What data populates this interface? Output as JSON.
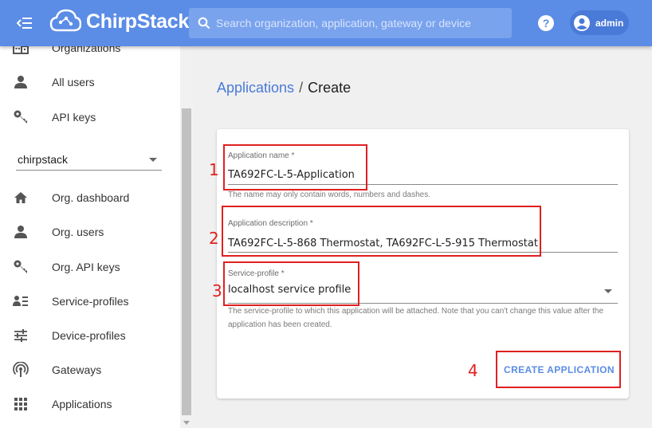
{
  "app": {
    "name": "ChirpStack"
  },
  "search": {
    "placeholder": "Search organization, application, gateway or device"
  },
  "user": {
    "name": "admin"
  },
  "sidebar": {
    "admin_items": [
      {
        "label": "Organizations",
        "icon": "organizations-icon"
      },
      {
        "label": "All users",
        "icon": "person-icon"
      },
      {
        "label": "API keys",
        "icon": "key-icon"
      }
    ],
    "organization_select": {
      "value": "chirpstack"
    },
    "org_items": [
      {
        "label": "Org. dashboard",
        "icon": "home-icon"
      },
      {
        "label": "Org. users",
        "icon": "person-icon"
      },
      {
        "label": "Org. API keys",
        "icon": "key-icon"
      },
      {
        "label": "Service-profiles",
        "icon": "service-profile-icon"
      },
      {
        "label": "Device-profiles",
        "icon": "tune-icon"
      },
      {
        "label": "Gateways",
        "icon": "gateway-icon"
      },
      {
        "label": "Applications",
        "icon": "apps-grid-icon"
      }
    ]
  },
  "breadcrumb": {
    "parent": "Applications",
    "separator": "/",
    "current": "Create"
  },
  "form": {
    "name": {
      "label": "Application name *",
      "value": "TA692FC-L-5-Application",
      "helper": "The name may only contain words, numbers and dashes."
    },
    "description": {
      "label": "Application description *",
      "value": "TA692FC-L-5-868 Thermostat, TA692FC-L-5-915 Thermostat"
    },
    "service_profile": {
      "label": "Service-profile *",
      "value": "localhost service profile",
      "helper": "The service-profile to which this application will be attached. Note that you can't change this value after the application has been created."
    },
    "submit_label": "CREATE APPLICATION"
  },
  "annotations": [
    "1",
    "2",
    "3",
    "4"
  ],
  "colors": {
    "accent": "#5b8ce6",
    "annotation": "#e02020"
  }
}
